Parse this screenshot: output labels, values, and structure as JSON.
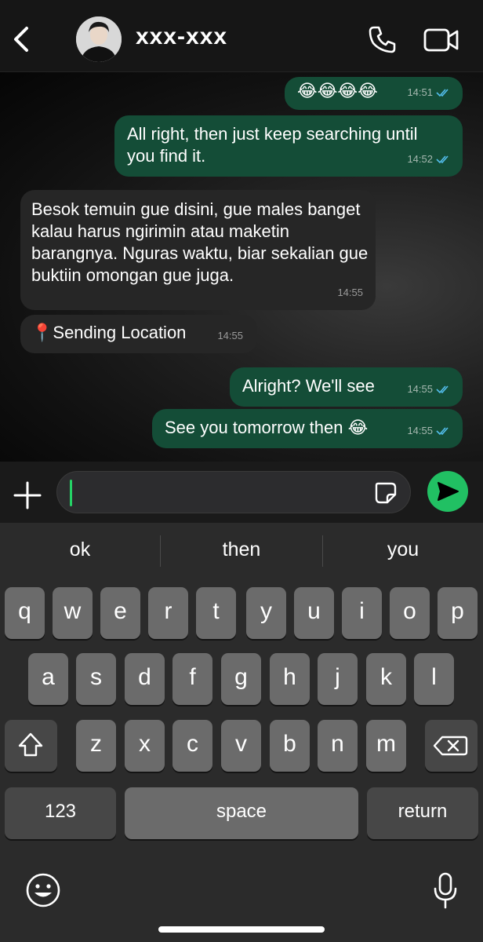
{
  "header": {
    "contact_name": "xxx-xxx",
    "icons": {
      "back": "chevron-left-icon",
      "call": "phone-icon",
      "video": "video-camera-icon"
    }
  },
  "messages": [
    {
      "direction": "out",
      "text": "😂😂😂😂",
      "time": "14:51",
      "status": "read"
    },
    {
      "direction": "out",
      "text": "All right, then just keep searching until you find it.",
      "time": "14:52",
      "status": "read"
    },
    {
      "direction": "in",
      "text": "Besok temuin gue disini, gue males banget kalau harus ngirimin atau maketin barangnya. Nguras waktu, biar sekalian gue buktiin omongan gue juga.",
      "time": "14:55"
    },
    {
      "direction": "in",
      "text": "📍Sending Location",
      "time": "14:55"
    },
    {
      "direction": "out",
      "text": "Alright? We'll see",
      "time": "14:55",
      "status": "read"
    },
    {
      "direction": "out",
      "text": "See you tomorrow then 😂",
      "time": "14:55",
      "status": "read"
    }
  ],
  "input": {
    "value": "",
    "placeholder": ""
  },
  "keyboard": {
    "suggestions": [
      "ok",
      "then",
      "you"
    ],
    "row1": [
      "q",
      "w",
      "e",
      "r",
      "t",
      "y",
      "u",
      "i",
      "o",
      "p"
    ],
    "row2": [
      "a",
      "s",
      "d",
      "f",
      "g",
      "h",
      "j",
      "k",
      "l"
    ],
    "row3": [
      "z",
      "x",
      "c",
      "v",
      "b",
      "n",
      "m"
    ],
    "numbers_label": "123",
    "space_label": "space",
    "return_label": "return"
  },
  "colors": {
    "outgoing_bubble": "#144d37",
    "incoming_bubble": "#262626",
    "send_button": "#21c063",
    "read_ticks": "#53bdeb"
  }
}
